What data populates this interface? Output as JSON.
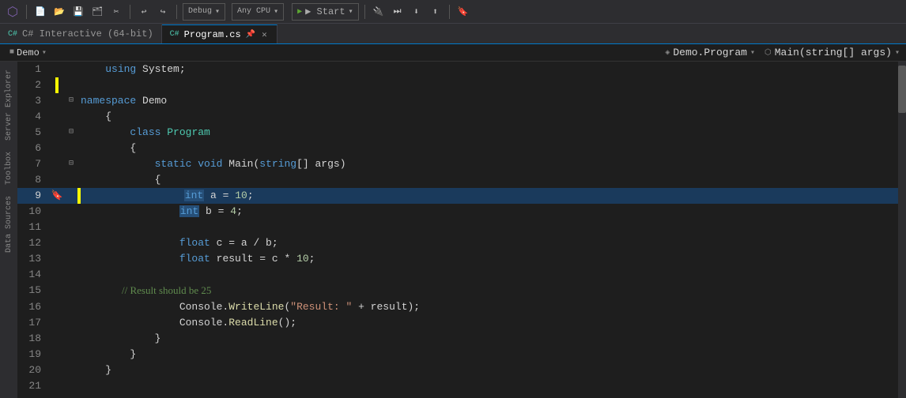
{
  "toolbar": {
    "items": [
      {
        "label": "⟳",
        "name": "back-button"
      },
      {
        "label": "→",
        "name": "forward-button"
      },
      {
        "sep": true
      },
      {
        "label": "📁",
        "name": "open-button"
      },
      {
        "label": "💾",
        "name": "save-button"
      },
      {
        "label": "💾",
        "name": "save-all-button"
      },
      {
        "label": "✏",
        "name": "edit-button"
      },
      {
        "sep": true
      },
      {
        "label": "↩",
        "name": "undo-button"
      },
      {
        "label": "↪",
        "name": "redo-button"
      },
      {
        "sep": true
      }
    ],
    "debug_config": "Debug",
    "cpu_config": "Any CPU",
    "start_label": "▶ Start",
    "start_dropdown": "▼"
  },
  "tabs": [
    {
      "label": "C# Interactive (64-bit)",
      "active": false,
      "closeable": false
    },
    {
      "label": "Program.cs",
      "active": true,
      "closeable": true,
      "modified": false
    }
  ],
  "breadcrumb": {
    "project": "Demo",
    "class": "Demo.Program",
    "method": "Main(string[] args)"
  },
  "sidebar": {
    "items": [
      "Server Explorer",
      "Toolbox",
      "Data Sources"
    ]
  },
  "code": {
    "lines": [
      {
        "num": 1,
        "content": "    using System;",
        "tokens": [
          {
            "text": "    ",
            "cls": "plain"
          },
          {
            "text": "using",
            "cls": "kw"
          },
          {
            "text": " System;",
            "cls": "plain"
          }
        ]
      },
      {
        "num": 2,
        "content": "",
        "tokens": []
      },
      {
        "num": 3,
        "content": "[-]namespace Demo",
        "fold": true,
        "tokens": [
          {
            "text": "namespace",
            "cls": "kw"
          },
          {
            "text": " Demo",
            "cls": "plain"
          }
        ]
      },
      {
        "num": 4,
        "content": "    {",
        "tokens": [
          {
            "text": "    {",
            "cls": "plain"
          }
        ]
      },
      {
        "num": 5,
        "content": "    [-]    class Program",
        "fold": true,
        "tokens": [
          {
            "text": "        ",
            "cls": "plain"
          },
          {
            "text": "class",
            "cls": "kw"
          },
          {
            "text": " ",
            "cls": "plain"
          },
          {
            "text": "Program",
            "cls": "type"
          }
        ]
      },
      {
        "num": 6,
        "content": "        {",
        "tokens": [
          {
            "text": "        {",
            "cls": "plain"
          }
        ]
      },
      {
        "num": 7,
        "content": "    [-]        static void Main(string[] args)",
        "fold": true,
        "tokens": [
          {
            "text": "            ",
            "cls": "plain"
          },
          {
            "text": "static",
            "cls": "kw"
          },
          {
            "text": " ",
            "cls": "plain"
          },
          {
            "text": "void",
            "cls": "kw"
          },
          {
            "text": " Main(",
            "cls": "plain"
          },
          {
            "text": "string",
            "cls": "kw"
          },
          {
            "text": "[] args)",
            "cls": "plain"
          }
        ]
      },
      {
        "num": 8,
        "content": "            {",
        "tokens": [
          {
            "text": "            {",
            "cls": "plain"
          }
        ]
      },
      {
        "num": 9,
        "content": "                int a = 10;",
        "debug": true,
        "bookmark": true,
        "tokens": [
          {
            "text": "                ",
            "cls": "plain"
          },
          {
            "text": "int",
            "cls": "highlight-kw"
          },
          {
            "text": " a = ",
            "cls": "plain"
          },
          {
            "text": "10",
            "cls": "num"
          },
          {
            "text": ";",
            "cls": "plain"
          }
        ]
      },
      {
        "num": 10,
        "content": "                int b = 4;",
        "tokens": [
          {
            "text": "                ",
            "cls": "plain"
          },
          {
            "text": "int",
            "cls": "highlight-kw"
          },
          {
            "text": " b = ",
            "cls": "plain"
          },
          {
            "text": "4",
            "cls": "num"
          },
          {
            "text": ";",
            "cls": "plain"
          }
        ]
      },
      {
        "num": 11,
        "content": "",
        "tokens": []
      },
      {
        "num": 12,
        "content": "                float c = a / b;",
        "tokens": [
          {
            "text": "                ",
            "cls": "plain"
          },
          {
            "text": "float",
            "cls": "kw"
          },
          {
            "text": " c = a / b;",
            "cls": "plain"
          }
        ]
      },
      {
        "num": 13,
        "content": "                float result = c * 10;",
        "tokens": [
          {
            "text": "                ",
            "cls": "plain"
          },
          {
            "text": "float",
            "cls": "kw"
          },
          {
            "text": " result = c * ",
            "cls": "plain"
          },
          {
            "text": "10",
            "cls": "num"
          },
          {
            "text": ";",
            "cls": "plain"
          }
        ]
      },
      {
        "num": 14,
        "content": "",
        "tokens": []
      },
      {
        "num": 15,
        "content": "                // Result should be 25",
        "tokens": [
          {
            "text": "                // Result should be 25",
            "cls": "comment"
          }
        ]
      },
      {
        "num": 16,
        "content": "                Console.WriteLine(\"Result: \" + result);",
        "tokens": [
          {
            "text": "                Console.",
            "cls": "plain"
          },
          {
            "text": "WriteLine",
            "cls": "method"
          },
          {
            "text": "(",
            "cls": "plain"
          },
          {
            "text": "\"Result: \"",
            "cls": "str"
          },
          {
            "text": " + result);",
            "cls": "plain"
          }
        ]
      },
      {
        "num": 17,
        "content": "                Console.ReadLine();",
        "tokens": [
          {
            "text": "                Console.",
            "cls": "plain"
          },
          {
            "text": "ReadLine",
            "cls": "method"
          },
          {
            "text": "();",
            "cls": "plain"
          }
        ]
      },
      {
        "num": 18,
        "content": "            }",
        "tokens": [
          {
            "text": "            }",
            "cls": "plain"
          }
        ]
      },
      {
        "num": 19,
        "content": "        }",
        "tokens": [
          {
            "text": "        }",
            "cls": "plain"
          }
        ]
      },
      {
        "num": 20,
        "content": "    }",
        "tokens": [
          {
            "text": "    }",
            "cls": "plain"
          }
        ]
      },
      {
        "num": 21,
        "content": "",
        "tokens": []
      }
    ]
  }
}
